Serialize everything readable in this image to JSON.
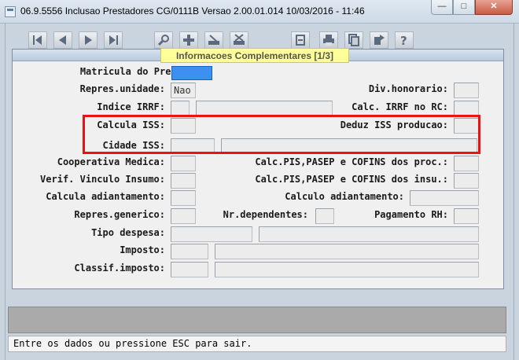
{
  "window": {
    "title": "06.9.5556  Inclusao  Prestadores CG/0111B Versao 2.00.01.014 10/03/2016 - 11:46",
    "minimize_glyph": "—",
    "maximize_glyph": "□",
    "close_glyph": "✕"
  },
  "toolbar": {
    "icons": [
      "first-record-icon",
      "previous-record-icon",
      "next-record-icon",
      "last-record-icon",
      "search-icon",
      "add-icon",
      "edit-icon",
      "delete-icon",
      "filter-icon",
      "print-icon",
      "copy-icon",
      "export-icon",
      "help-icon"
    ]
  },
  "panel": {
    "title": "Informacoes Complementares [1/3]"
  },
  "form": {
    "matricula_label": "Matricula do Prestador:",
    "repres_unidade_label": "Repres.unidade:",
    "repres_unidade_value": "Nao",
    "div_honorario_label": "Div.honorario:",
    "indice_irrf_label": "Indice IRRF:",
    "calc_irrf_label": "Calc. IRRF no RC:",
    "calcula_iss_label": "Calcula ISS:",
    "deduz_iss_label": "Deduz ISS producao:",
    "cidade_iss_label": "Cidade ISS:",
    "cooperativa_label": "Cooperativa Medica:",
    "calc_pis_proc_label": "Calc.PIS,PASEP e COFINS dos proc.:",
    "verif_vinculo_label": "Verif. Vinculo Insumo:",
    "calc_pis_insu_label": "Calc.PIS,PASEP e COFINS dos insu.:",
    "calcula_adiant_label": "Calcula adiantamento:",
    "calculo_adiant_label": "Calculo adiantamento:",
    "repres_generico_label": "Repres.generico:",
    "nr_dependentes_label": "Nr.dependentes:",
    "pagamento_rh_label": "Pagamento RH:",
    "tipo_despesa_label": "Tipo despesa:",
    "imposto_label": "Imposto:",
    "classif_imposto_label": "Classif.imposto:"
  },
  "status": {
    "message": "Entre os dados ou pressione ESC para sair."
  },
  "colors": {
    "highlight": "#ee1111",
    "focused_field": "#3d8ff0",
    "panel_title_bg": "#ffff99"
  }
}
